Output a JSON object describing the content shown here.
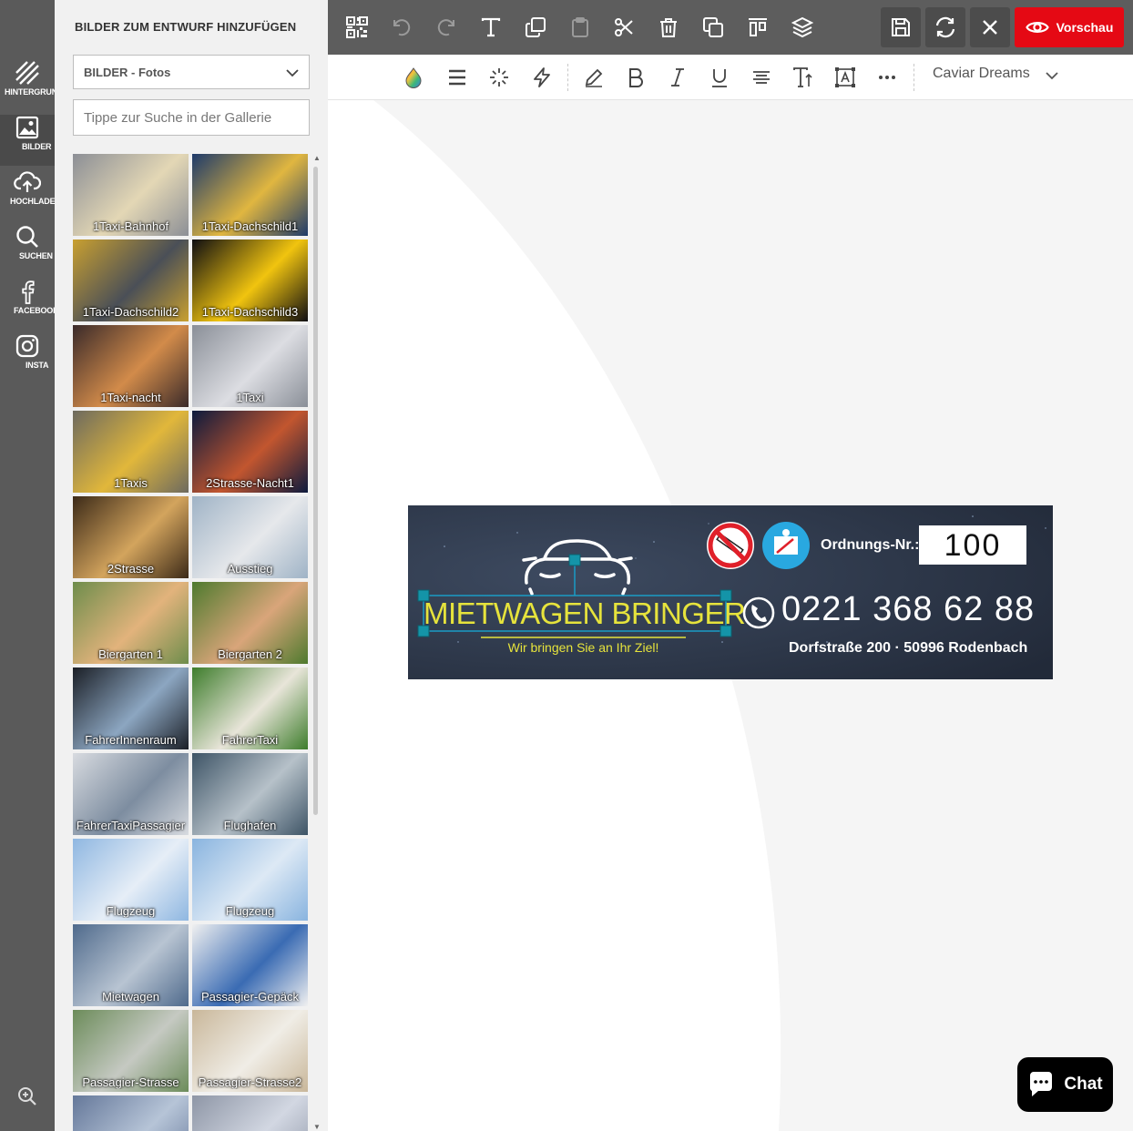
{
  "rail": {
    "items": [
      {
        "label": "HINTERGRUND",
        "icon": "stripes-icon"
      },
      {
        "label": "BILDER",
        "icon": "image-icon"
      },
      {
        "label": "HOCHLADEN",
        "icon": "upload-cloud-icon"
      },
      {
        "label": "SUCHEN",
        "icon": "search-icon"
      },
      {
        "label": "FACEBOOK",
        "icon": "facebook-icon"
      },
      {
        "label": "INSTA",
        "icon": "instagram-icon"
      }
    ],
    "active": "BILDER"
  },
  "panel": {
    "title": "BILDER ZUM ENTWURF HINZUFÜGEN",
    "category_value": "BILDER - Fotos",
    "search_placeholder": "Tippe zur Suche in der Gallerie",
    "gallery": [
      {
        "name": "1Taxi-Bahnhof",
        "c1": "#8c8f96",
        "c2": "#e3d7b5"
      },
      {
        "name": "1Taxi-Dachschild1",
        "c1": "#1e3a6a",
        "c2": "#e0b640"
      },
      {
        "name": "1Taxi-Dachschild2",
        "c1": "#c9a030",
        "c2": "#4a4f57"
      },
      {
        "name": "1Taxi-Dachschild3",
        "c1": "#0f0e12",
        "c2": "#f1c40f"
      },
      {
        "name": "1Taxi-nacht",
        "c1": "#3a2a2a",
        "c2": "#d28b4a"
      },
      {
        "name": "1Taxi",
        "c1": "#8a8f98",
        "c2": "#dcdde2"
      },
      {
        "name": "1Taxis",
        "c1": "#6d6a5f",
        "c2": "#e1b73b"
      },
      {
        "name": "2Strasse-Nacht1",
        "c1": "#0d1a3d",
        "c2": "#c2562f"
      },
      {
        "name": "2Strasse",
        "c1": "#3c2a18",
        "c2": "#d3a45d"
      },
      {
        "name": "Ausstieg",
        "c1": "#9fb3c6",
        "c2": "#e6e8eb"
      },
      {
        "name": "Biergarten 1",
        "c1": "#6e8d4c",
        "c2": "#e2b37c"
      },
      {
        "name": "Biergarten 2",
        "c1": "#4e7a2e",
        "c2": "#d9a57a"
      },
      {
        "name": "FahrerInnenraum",
        "c1": "#1b1f26",
        "c2": "#8ca6c1"
      },
      {
        "name": "FahrerTaxi",
        "c1": "#3e7d2c",
        "c2": "#e8e5d9"
      },
      {
        "name": "FahrerTaxiPassagier",
        "c1": "#d8dbe0",
        "c2": "#7d8da0"
      },
      {
        "name": "Flughafen",
        "c1": "#3e5466",
        "c2": "#b6c1c9"
      },
      {
        "name": "Flugzeug",
        "c1": "#8fb7e1",
        "c2": "#e6eef7"
      },
      {
        "name": "Flugzeug",
        "c1": "#89b4df",
        "c2": "#dde9f5"
      },
      {
        "name": "Mietwagen",
        "c1": "#4f6a8c",
        "c2": "#b8c4d2"
      },
      {
        "name": "Passagier-Gepäck",
        "c1": "#f0f0f0",
        "c2": "#3a6bb3"
      },
      {
        "name": "Passagier-Strasse",
        "c1": "#6c8c5a",
        "c2": "#c5c9c2"
      },
      {
        "name": "Passagier-Strasse2",
        "c1": "#c9b79a",
        "c2": "#f0ede6"
      },
      {
        "name": "",
        "c1": "#65789a",
        "c2": "#b6c4d7"
      },
      {
        "name": "",
        "c1": "#8e96a6",
        "c2": "#d2d7e2"
      }
    ]
  },
  "topbar": {
    "tools": [
      {
        "name": "qr-code-icon"
      },
      {
        "name": "undo-icon"
      },
      {
        "name": "redo-icon"
      },
      {
        "name": "text-icon"
      },
      {
        "name": "clone-icon"
      },
      {
        "name": "paste-icon"
      },
      {
        "name": "cut-icon"
      },
      {
        "name": "delete-icon"
      },
      {
        "name": "copy-icon"
      },
      {
        "name": "align-top-icon"
      },
      {
        "name": "layers-icon"
      }
    ],
    "preview_label": "Vorschau",
    "accent": "#e50914"
  },
  "fmtbar": {
    "font_value": "Caviar Dreams"
  },
  "design": {
    "order_label": "Ordnungs-Nr.:",
    "order_number": "100",
    "title": "MIETWAGEN BRINGER",
    "slogan": "Wir bringen Sie an Ihr Ziel!",
    "phone": "0221 368 62 88",
    "address": "Dorfstraße 200 · 50996 Rodenbach",
    "bg_color": "#2a3446",
    "title_color": "#e6e33c"
  },
  "chat": {
    "label": "Chat"
  }
}
